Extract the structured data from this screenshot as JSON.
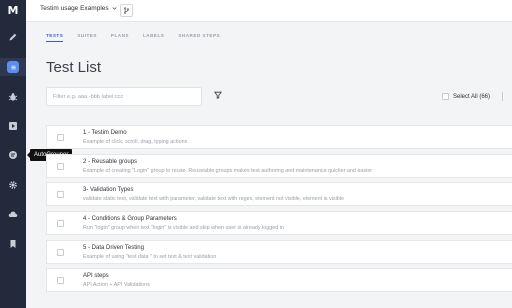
{
  "sidebar": {
    "logo": "M",
    "items": [
      {
        "icon": "pencil-icon"
      },
      {
        "icon": "test-list-icon",
        "active": true
      },
      {
        "icon": "bug-icon"
      },
      {
        "icon": "play-icon"
      },
      {
        "icon": "auto-grouper-icon"
      },
      {
        "icon": "gear-icon"
      },
      {
        "icon": "cloud-icon"
      },
      {
        "icon": "bookmark-icon"
      }
    ],
    "tooltip": "AutoGrouper"
  },
  "topbar": {
    "project_name": "Testim usage Examples"
  },
  "tabs": [
    "TESTS",
    "SUITES",
    "PLANS",
    "LABELS",
    "SHARED STEPS"
  ],
  "page_title": "Test List",
  "filter": {
    "placeholder": "Filter e.g. aaa -bbb label:ccc"
  },
  "select_all_label": "Select All (66)",
  "tests": [
    {
      "title": "1 - Testim Demo",
      "description": "Example of click, scroll, drag, typing actions"
    },
    {
      "title": "2 - Reusable groups",
      "description": "Example of creating \"Login\" group to reuse. Reuseable groups makes test authoring and maintenance quicker and easier"
    },
    {
      "title": "3- Validation Types",
      "description": "validate static text, validate text with parameter, validate text with regex, element not visible, element is visible"
    },
    {
      "title": "4 - Conditions & Group Parameters",
      "description": "Run \"login\" group when text \"login\" is visible and skip when user is already logged in"
    },
    {
      "title": "5 - Data Driven Testing",
      "description": "Example of using \"test data \" to set text & text validation"
    },
    {
      "title": "API steps",
      "description": "API Action + API Validations"
    }
  ],
  "colors": {
    "sidebar_bg": "#232a3b",
    "accent": "#3b5bdb",
    "active_tile": "#5b8def"
  }
}
